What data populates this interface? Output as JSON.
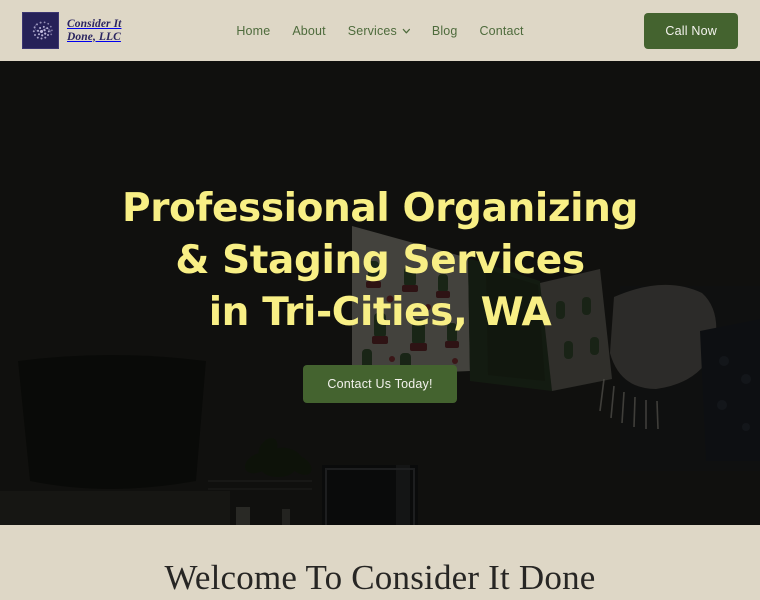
{
  "theme": {
    "page_bg": "#ded7c6",
    "accent_green": "#44632f",
    "nav_green": "#4e6b3c",
    "hero_yellow": "#f8ef85",
    "logo_navy": "#262158",
    "heading_dark": "#272624"
  },
  "header": {
    "logo": {
      "icon": "spiral-shell-icon",
      "line1": "Consider It",
      "line2": "Done, LLC",
      "text": "Consider It\nDone, LLC"
    },
    "nav": [
      {
        "label": "Home",
        "name": "home",
        "dropdown": false
      },
      {
        "label": "About",
        "name": "about",
        "dropdown": false
      },
      {
        "label": "Services",
        "name": "services",
        "dropdown": true
      },
      {
        "label": "Blog",
        "name": "blog",
        "dropdown": false
      },
      {
        "label": "Contact",
        "name": "contact",
        "dropdown": false
      }
    ],
    "call_button": "Call Now"
  },
  "hero": {
    "title_line1": "Professional Organizing",
    "title_line2": "& Staging Services",
    "title_line3": "in Tri-Cities, WA",
    "cta_label": "Contact Us Today!",
    "background_description": "Dark dimmed photo of a living room: snake plant silhouette at left, cactus-print throw pillows and white fringed blanket on a dark couch, mason jar with plant and glass vase in foreground"
  },
  "welcome": {
    "heading": "Welcome To Consider It Done"
  }
}
